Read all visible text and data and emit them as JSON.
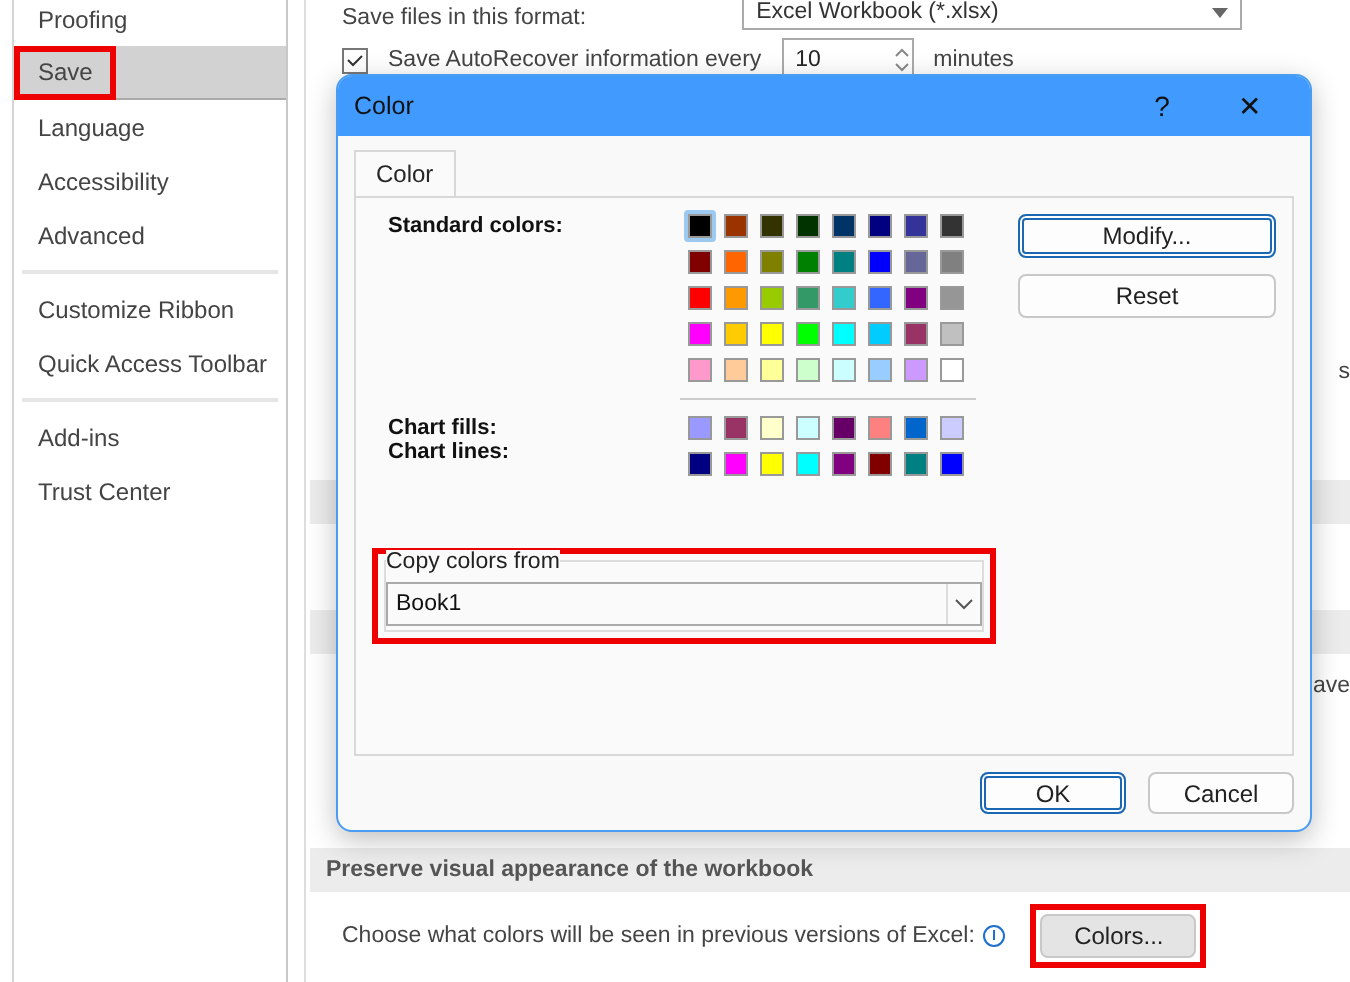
{
  "sidebar": {
    "items": [
      {
        "label": "Proofing",
        "selected": false,
        "highlighted": false,
        "group_end": false
      },
      {
        "label": "Save",
        "selected": true,
        "highlighted": true,
        "group_end": false
      },
      {
        "label": "Language",
        "selected": false,
        "highlighted": false,
        "group_end": false
      },
      {
        "label": "Accessibility",
        "selected": false,
        "highlighted": false,
        "group_end": false
      },
      {
        "label": "Advanced",
        "selected": false,
        "highlighted": false,
        "group_end": true
      },
      {
        "label": "Customize Ribbon",
        "selected": false,
        "highlighted": false,
        "group_end": false
      },
      {
        "label": "Quick Access Toolbar",
        "selected": false,
        "highlighted": false,
        "group_end": true
      },
      {
        "label": "Add-ins",
        "selected": false,
        "highlighted": false,
        "group_end": false
      },
      {
        "label": "Trust Center",
        "selected": false,
        "highlighted": false,
        "group_end": false
      }
    ]
  },
  "options": {
    "format_label": "Save files in this format:",
    "format_value": "Excel Workbook (*.xlsx)",
    "autorecover": {
      "label": "Save AutoRecover information every",
      "checked": true,
      "value": "10",
      "unit": "minutes"
    },
    "partial_text_1": "s",
    "partial_text_2": "ave",
    "section_title": "Preserve visual appearance of the workbook",
    "colors_prompt": "Choose what colors will be seen in previous versions of Excel:",
    "colors_button": {
      "label": "Colors...",
      "highlighted": true
    }
  },
  "dialog": {
    "title": "Color",
    "help": "?",
    "close": "✕",
    "tabs": [
      {
        "label": "Color",
        "selected": true
      }
    ],
    "standard_label": "Standard colors:",
    "standard_colors": [
      {
        "color": "#000000",
        "selected": true
      },
      {
        "color": "#993300",
        "selected": false
      },
      {
        "color": "#333300",
        "selected": false
      },
      {
        "color": "#003300",
        "selected": false
      },
      {
        "color": "#003366",
        "selected": false
      },
      {
        "color": "#000080",
        "selected": false
      },
      {
        "color": "#333399",
        "selected": false
      },
      {
        "color": "#333333",
        "selected": false
      },
      {
        "color": "#800000",
        "selected": false
      },
      {
        "color": "#ff6600",
        "selected": false
      },
      {
        "color": "#808000",
        "selected": false
      },
      {
        "color": "#008000",
        "selected": false
      },
      {
        "color": "#008080",
        "selected": false
      },
      {
        "color": "#0000ff",
        "selected": false
      },
      {
        "color": "#666699",
        "selected": false
      },
      {
        "color": "#808080",
        "selected": false
      },
      {
        "color": "#ff0000",
        "selected": false
      },
      {
        "color": "#ff9900",
        "selected": false
      },
      {
        "color": "#99cc00",
        "selected": false
      },
      {
        "color": "#339966",
        "selected": false
      },
      {
        "color": "#33cccc",
        "selected": false
      },
      {
        "color": "#3366ff",
        "selected": false
      },
      {
        "color": "#800080",
        "selected": false
      },
      {
        "color": "#969696",
        "selected": false
      },
      {
        "color": "#ff00ff",
        "selected": false
      },
      {
        "color": "#ffcc00",
        "selected": false
      },
      {
        "color": "#ffff00",
        "selected": false
      },
      {
        "color": "#00ff00",
        "selected": false
      },
      {
        "color": "#00ffff",
        "selected": false
      },
      {
        "color": "#00ccff",
        "selected": false
      },
      {
        "color": "#993366",
        "selected": false
      },
      {
        "color": "#c0c0c0",
        "selected": false
      },
      {
        "color": "#ff99cc",
        "selected": false
      },
      {
        "color": "#ffcc99",
        "selected": false
      },
      {
        "color": "#ffff99",
        "selected": false
      },
      {
        "color": "#ccffcc",
        "selected": false
      },
      {
        "color": "#ccffff",
        "selected": false
      },
      {
        "color": "#99ccff",
        "selected": false
      },
      {
        "color": "#cc99ff",
        "selected": false
      },
      {
        "color": "#ffffff",
        "selected": false
      }
    ],
    "chart_fills_label": "Chart fills:",
    "chart_fills": [
      {
        "color": "#9999ff",
        "selected": false
      },
      {
        "color": "#993366",
        "selected": false
      },
      {
        "color": "#ffffcc",
        "selected": false
      },
      {
        "color": "#ccffff",
        "selected": false
      },
      {
        "color": "#660066",
        "selected": false
      },
      {
        "color": "#ff8080",
        "selected": false
      },
      {
        "color": "#0066cc",
        "selected": false
      },
      {
        "color": "#ccccff",
        "selected": false
      }
    ],
    "chart_lines_label": "Chart lines:",
    "chart_lines": [
      {
        "color": "#000080",
        "selected": false
      },
      {
        "color": "#ff00ff",
        "selected": false
      },
      {
        "color": "#ffff00",
        "selected": false
      },
      {
        "color": "#00ffff",
        "selected": false
      },
      {
        "color": "#800080",
        "selected": false
      },
      {
        "color": "#800000",
        "selected": false
      },
      {
        "color": "#008080",
        "selected": false
      },
      {
        "color": "#0000ff",
        "selected": false
      }
    ],
    "side_buttons": [
      "Modify...",
      "Reset"
    ],
    "copy_from": {
      "label": "Copy colors from",
      "value": "Book1",
      "highlighted": true
    },
    "buttons": [
      "OK",
      "Cancel"
    ]
  }
}
